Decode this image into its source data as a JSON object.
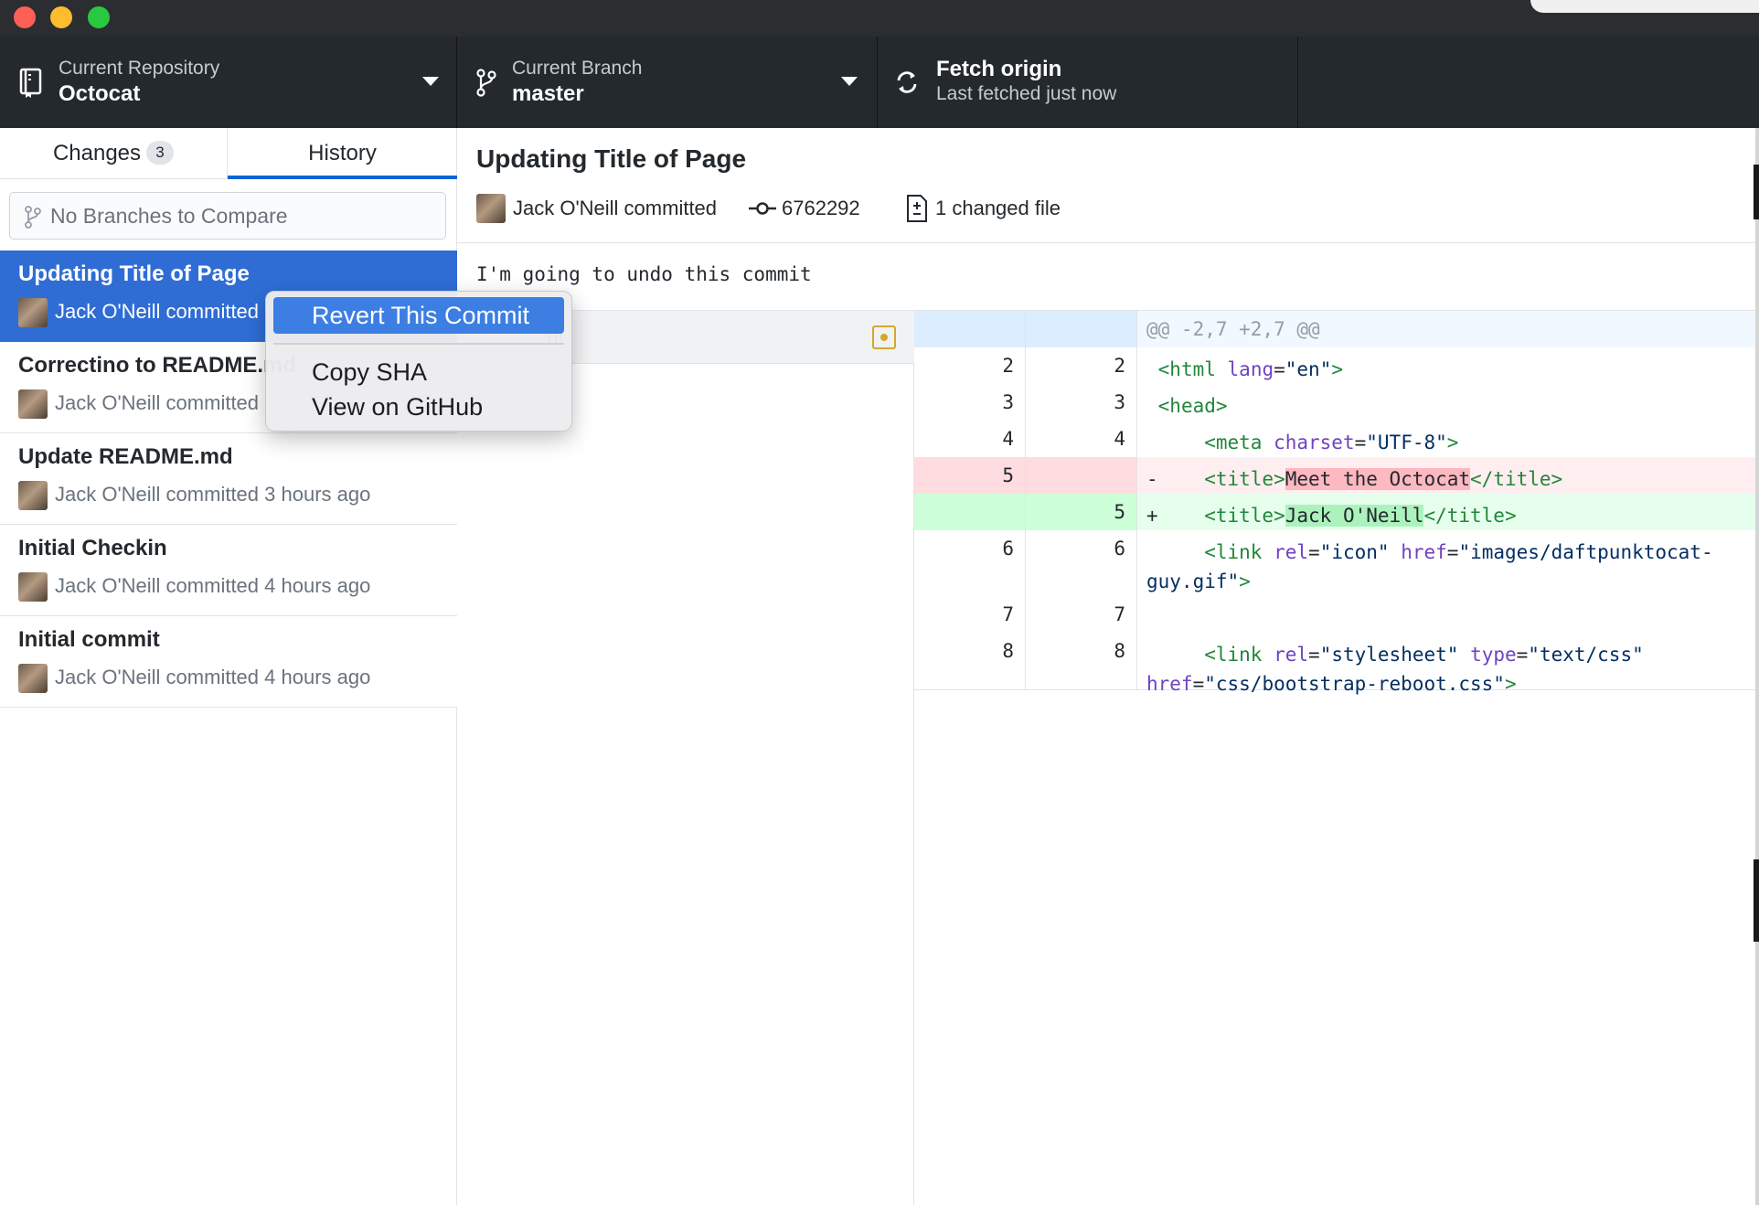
{
  "toolbar": {
    "repository": {
      "caption": "Current Repository",
      "value": "Octocat"
    },
    "branch": {
      "caption": "Current Branch",
      "value": "master"
    },
    "fetch": {
      "title": "Fetch origin",
      "caption": "Last fetched just now"
    }
  },
  "sidebar": {
    "tabs": {
      "changes_label": "Changes",
      "changes_count": "3",
      "history_label": "History"
    },
    "compare_placeholder": "No Branches to Compare",
    "commits": [
      {
        "title": "Updating Title of Page",
        "meta": "Jack O'Neill committed"
      },
      {
        "title": "Correctino to README.md",
        "meta": "Jack O'Neill committed"
      },
      {
        "title": "Update README.md",
        "meta": "Jack O'Neill committed 3 hours ago"
      },
      {
        "title": "Initial Checkin",
        "meta": "Jack O'Neill committed 4 hours ago"
      },
      {
        "title": "Initial commit",
        "meta": "Jack O'Neill committed 4 hours ago"
      }
    ]
  },
  "context_menu": {
    "items": [
      "Revert This Commit",
      "Copy SHA",
      "View on GitHub"
    ]
  },
  "commit_detail": {
    "title": "Updating Title of Page",
    "author": "Jack O'Neill committed",
    "sha": "6762292",
    "changed_files": "1 changed file",
    "body": "I'm going to undo this commit",
    "file_name": "nl"
  },
  "diff": {
    "hunk_header": "@@ -2,7 +2,7 @@",
    "rows": [
      {
        "old": "2",
        "new": "2"
      },
      {
        "old": "3",
        "new": "3"
      },
      {
        "old": "4",
        "new": "4"
      },
      {
        "old": "5",
        "new": ""
      },
      {
        "old": "",
        "new": "5"
      },
      {
        "old": "6",
        "new": "6"
      },
      {
        "old": "7",
        "new": "7"
      },
      {
        "old": "8",
        "new": "8"
      }
    ]
  },
  "colors": {
    "toolbar_bg": "#24292e",
    "selection_blue": "#2f6dd5",
    "menu_highlight": "#3d7ee3",
    "deleted_line": "#ffeef0",
    "added_line": "#e6ffed"
  }
}
